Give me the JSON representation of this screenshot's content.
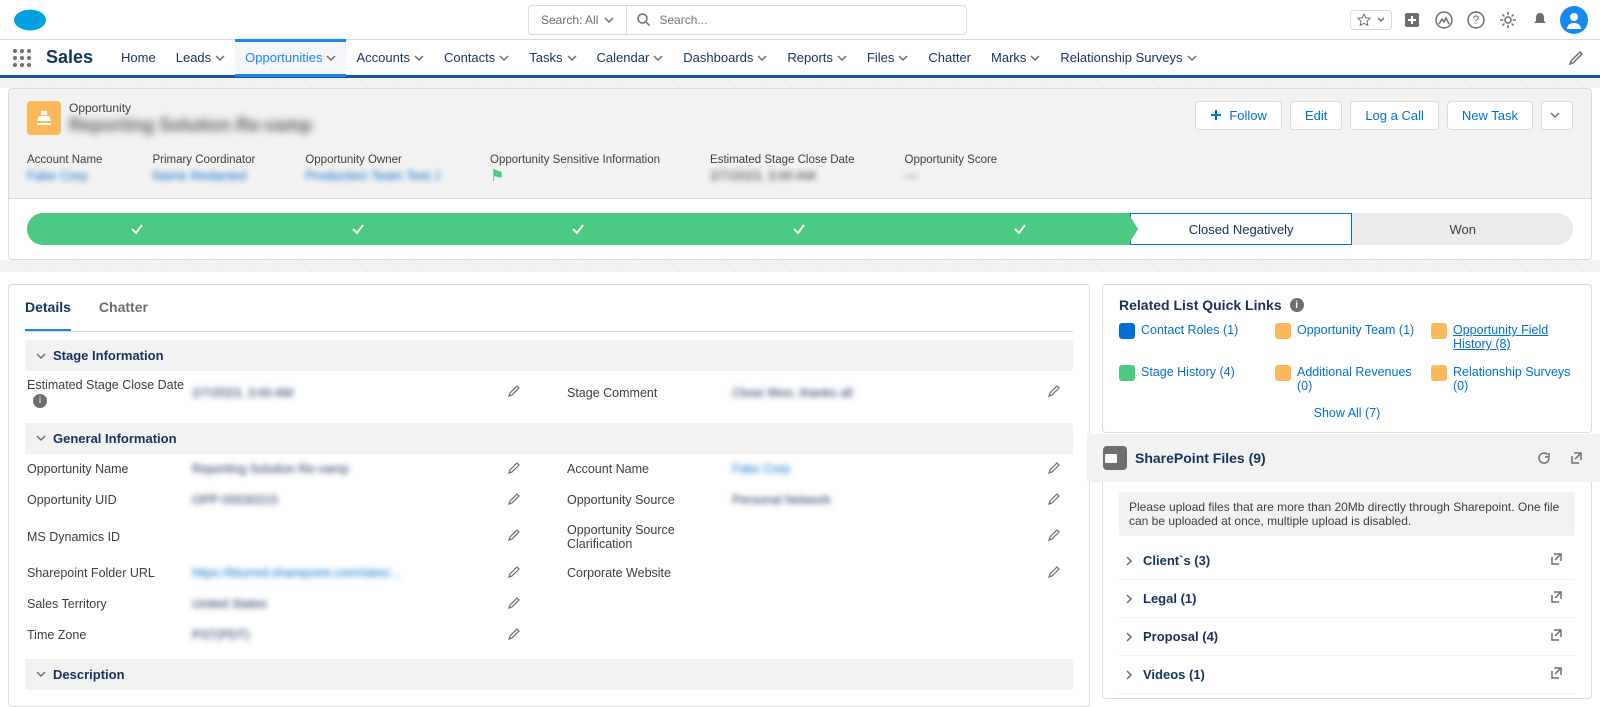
{
  "app_name": "Sales",
  "search": {
    "scope": "Search: All",
    "placeholder": "Search..."
  },
  "nav": [
    "Home",
    "Leads",
    "Opportunities",
    "Accounts",
    "Contacts",
    "Tasks",
    "Calendar",
    "Dashboards",
    "Reports",
    "Files",
    "Chatter",
    "Marks",
    "Relationship Surveys"
  ],
  "nav_active": "Opportunities",
  "record": {
    "object_label": "Opportunity",
    "name_blurred": "Reporting Solution Re-vamp",
    "actions": {
      "follow": "Follow",
      "edit": "Edit",
      "log_call": "Log a Call",
      "new_task": "New Task"
    },
    "fields": [
      {
        "label": "Account Name",
        "value": "Fabx Corp",
        "link": true
      },
      {
        "label": "Primary Coordinator",
        "value": "Name Redacted",
        "link": true
      },
      {
        "label": "Opportunity Owner",
        "value": "Production Team Test J",
        "link": true
      },
      {
        "label": "Opportunity Sensitive Information",
        "value": "flag"
      },
      {
        "label": "Estimated Stage Close Date",
        "value": "2/7/2023, 3:00 AM"
      },
      {
        "label": "Opportunity Score",
        "value": "—"
      }
    ]
  },
  "path": {
    "complete_count": 5,
    "current": "Closed Negatively",
    "future": "Won"
  },
  "tabs": [
    "Details",
    "Chatter"
  ],
  "tab_active": "Details",
  "sections": {
    "stage_info": {
      "title": "Stage Information",
      "rows": [
        {
          "label": "Estimated Stage Close Date",
          "value": "2/7/2023, 3:00 AM",
          "info": true
        },
        {
          "label": "Stage Comment",
          "value": "Close Won, thanks all"
        }
      ]
    },
    "general_info": {
      "title": "General Information",
      "left": [
        {
          "label": "Opportunity Name",
          "value": "Reporting Solution Re-vamp"
        },
        {
          "label": "Opportunity UID",
          "value": "OPP-00030215"
        },
        {
          "label": "MS Dynamics ID",
          "value": ""
        },
        {
          "label": "Sharepoint Folder URL",
          "value": "https://blurred.sharepoint.com/sites/...",
          "link": true
        },
        {
          "label": "Sales Territory",
          "value": "United States"
        },
        {
          "label": "Time Zone",
          "value": "PST(PDT)"
        }
      ],
      "right": [
        {
          "label": "Account Name",
          "value": "Fabx Corp",
          "link": true
        },
        {
          "label": "Opportunity Source",
          "value": "Personal Network"
        },
        {
          "label": "Opportunity Source Clarification",
          "value": ""
        },
        {
          "label": "Corporate Website",
          "value": ""
        }
      ]
    },
    "description": {
      "title": "Description"
    }
  },
  "quick_links": {
    "title": "Related List Quick Links",
    "items": [
      {
        "label": "Contact Roles (1)",
        "color": "#0070d2"
      },
      {
        "label": "Opportunity Team (1)",
        "color": "#fcb95b"
      },
      {
        "label": "Opportunity Field History (8)",
        "color": "#fcb95b",
        "underline": true
      },
      {
        "label": "Stage History (4)",
        "color": "#4bca81"
      },
      {
        "label": "Additional Revenues (0)",
        "color": "#fcb95b"
      },
      {
        "label": "Relationship Surveys (0)",
        "color": "#fcb95b"
      }
    ],
    "show_all": "Show All (7)"
  },
  "sharepoint": {
    "title": "SharePoint Files (9)",
    "note": "Please upload files that are more than 20Mb directly through Sharepoint. One file can be uploaded at once, multiple upload is disabled.",
    "folders": [
      {
        "name": "Client`s (3)"
      },
      {
        "name": "Legal (1)"
      },
      {
        "name": "Proposal (4)"
      },
      {
        "name": "Videos (1)"
      }
    ]
  }
}
